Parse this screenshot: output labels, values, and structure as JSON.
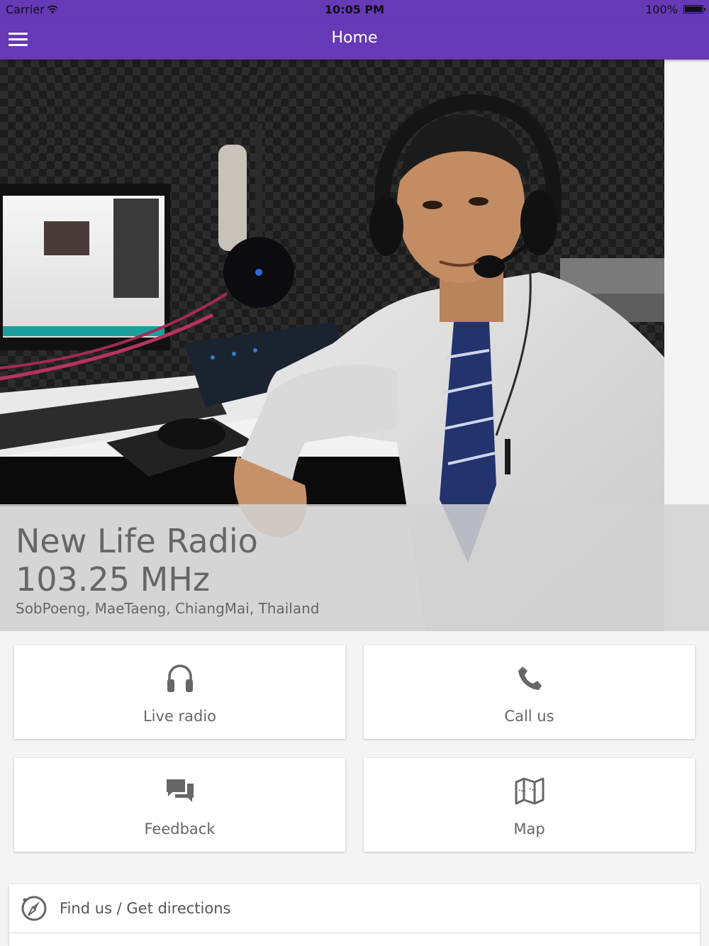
{
  "status_bar": {
    "carrier": "Carrier",
    "time": "10:05 PM",
    "battery": "100%"
  },
  "app_bar": {
    "title": "Home",
    "menu_icon": "hamburger-menu-icon"
  },
  "hero": {
    "photo": "radio-host-in-studio-photo",
    "station_name": "New Life Radio",
    "frequency": "103.25 MHz",
    "location": "SobPoeng, MaeTaeng, ChiangMai, Thailand"
  },
  "tiles": [
    {
      "label": "Live radio",
      "icon": "headphones-icon"
    },
    {
      "label": "Call us",
      "icon": "phone-icon"
    },
    {
      "label": "Feedback",
      "icon": "chat-bubbles-icon"
    },
    {
      "label": "Map",
      "icon": "map-icon"
    }
  ],
  "find_us": {
    "label": "Find us / Get directions",
    "icon": "compass-icon"
  },
  "colors": {
    "brand": "#6639b7",
    "background": "#f4f4f4",
    "tile": "#ffffff",
    "text": "#666666"
  }
}
